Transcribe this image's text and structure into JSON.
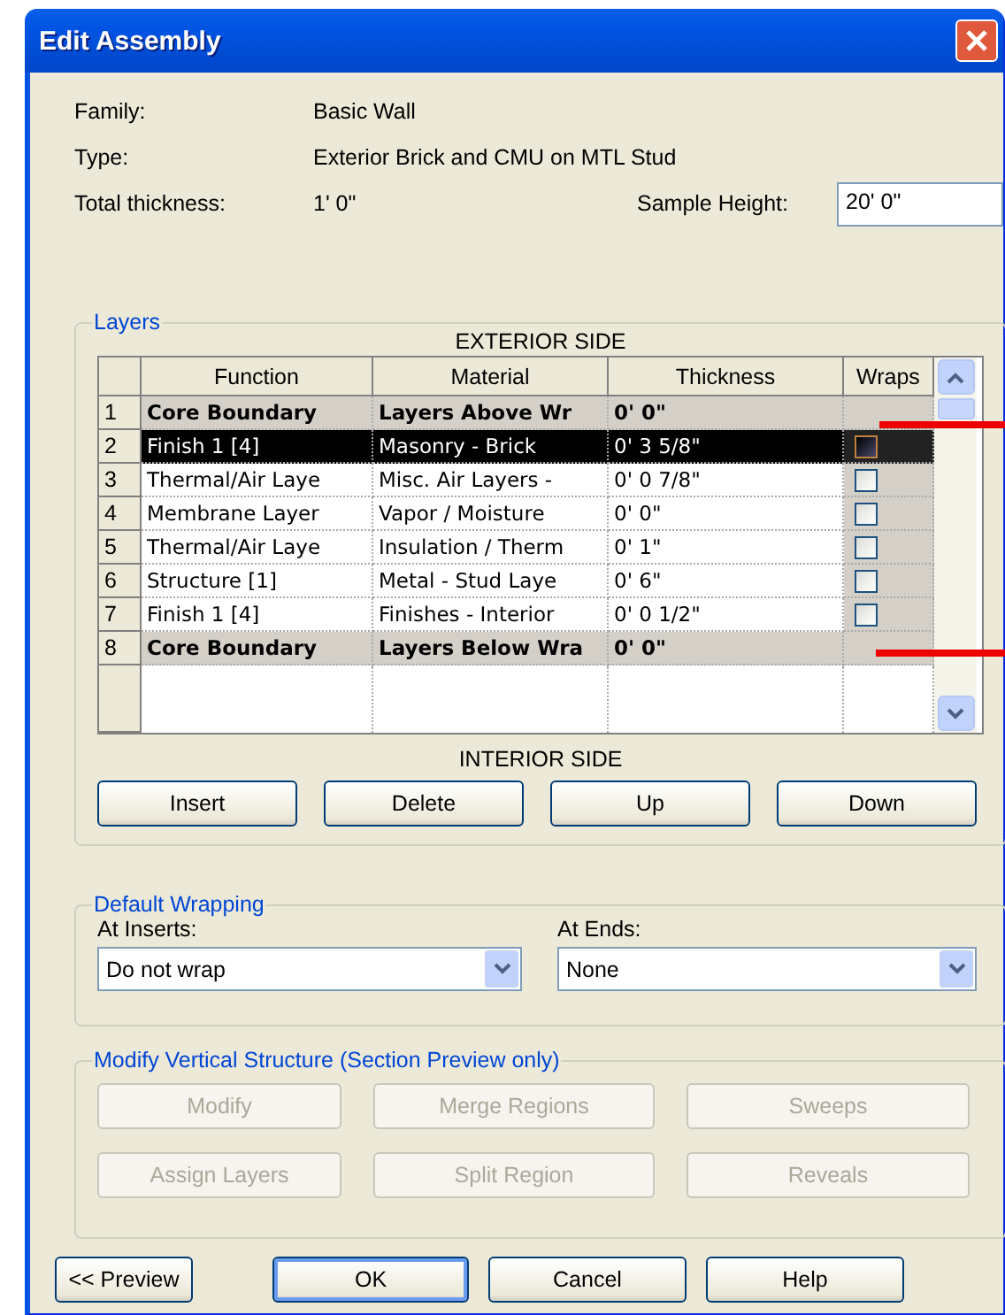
{
  "window": {
    "title": "Edit Assembly"
  },
  "properties": [
    {
      "label": "Family:",
      "value": "Basic Wall"
    },
    {
      "label": "Type:",
      "value": "Exterior Brick and CMU on MTL Stud"
    },
    {
      "label": "Total thickness:",
      "value": "1'  0\""
    }
  ],
  "sample_height": {
    "label": "Sample Height:",
    "value": "20'  0\""
  },
  "layers": {
    "legend": "Layers",
    "top_caption": "EXTERIOR SIDE",
    "columns": [
      "Function",
      "Material",
      "Thickness",
      "Wraps"
    ],
    "rows": [
      {
        "number": "1",
        "kind": "boundary",
        "function": "Core Boundary",
        "material": "Layers Above Wr",
        "thickness": "0'  0\"",
        "selected": false
      },
      {
        "number": "2",
        "kind": "layer",
        "function": "Finish 1 [4]",
        "material": "Masonry - Brick",
        "thickness": "0'  3 5/8\"",
        "checked": false,
        "selected": true
      },
      {
        "number": "3",
        "kind": "layer",
        "function": "Thermal/Air Laye",
        "material": "Misc. Air Layers -",
        "thickness": "0'  0 7/8\"",
        "checked": false,
        "selected": false
      },
      {
        "number": "4",
        "kind": "layer",
        "function": "Membrane Layer",
        "material": "Vapor / Moisture",
        "thickness": "0'  0\"",
        "checked": false,
        "selected": false
      },
      {
        "number": "5",
        "kind": "layer",
        "function": "Thermal/Air Laye",
        "material": "Insulation / Therm",
        "thickness": "0'  1\"",
        "checked": false,
        "selected": false
      },
      {
        "number": "6",
        "kind": "layer",
        "function": "Structure [1]",
        "material": "Metal - Stud Laye",
        "thickness": "0'  6\"",
        "checked": false,
        "selected": false
      },
      {
        "number": "7",
        "kind": "layer",
        "function": "Finish 1 [4]",
        "material": "Finishes - Interior",
        "thickness": "0'  0 1/2\"",
        "checked": false,
        "selected": false
      },
      {
        "number": "8",
        "kind": "boundary",
        "function": "Core Boundary",
        "material": "Layers Below Wra",
        "thickness": "0'  0\"",
        "selected": false
      }
    ],
    "bottom_caption": "INTERIOR SIDE",
    "buttons": [
      "Insert",
      "Delete",
      "Up",
      "Down"
    ]
  },
  "default_wrapping": {
    "legend": "Default Wrapping",
    "at_inserts": {
      "label": "At Inserts:",
      "value": "Do not wrap"
    },
    "at_ends": {
      "label": "At  Ends:",
      "value": "None"
    }
  },
  "modify_vertical": {
    "legend": "Modify Vertical Structure (Section Preview only)",
    "buttons": [
      {
        "label": "Modify",
        "disabled": true
      },
      {
        "label": "Merge Regions",
        "disabled": true
      },
      {
        "label": "Sweeps",
        "disabled": true
      },
      {
        "label": "Assign Layers",
        "disabled": true
      },
      {
        "label": "Split Region",
        "disabled": true
      },
      {
        "label": "Reveals",
        "disabled": true
      }
    ]
  },
  "footer_buttons": [
    {
      "label": "<< Preview",
      "default": false
    },
    {
      "label": "OK",
      "default": true
    },
    {
      "label": "Cancel",
      "default": false
    },
    {
      "label": "Help",
      "default": false
    }
  ]
}
